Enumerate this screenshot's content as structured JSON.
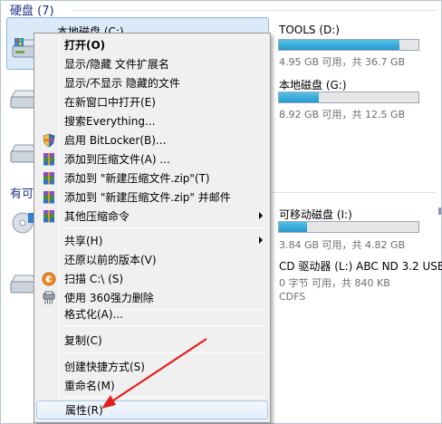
{
  "explorer": {
    "groups": [
      {
        "label": "硬盘 (7)"
      },
      {
        "label": "有可"
      }
    ],
    "drives": [
      {
        "name": "本地磁盘 (C:)",
        "usage": 0.0
      },
      {
        "name": "TOOLS (D:)",
        "info": "4.95 GB 可用，共 36.7 GB",
        "usage": 0.865
      },
      {
        "name": "本地磁盘 (G:)",
        "info": "8.92 GB 可用，共 12.5 GB",
        "usage": 0.286
      },
      {
        "name": "可移动磁盘 (I:)",
        "info": "3.84 GB 可用，共 4.82 GB",
        "usage": 0.203
      },
      {
        "name": "CD 驱动器 (L:) ABC ND 3.2 USE",
        "info": "0 字节 可用，共 840 KB",
        "info2": "CDFS"
      }
    ]
  },
  "menu": {
    "items": [
      {
        "label": "打开(O)",
        "bold": true
      },
      {
        "label": "显示/隐藏 文件扩展名"
      },
      {
        "label": "显示/不显示 隐藏的文件"
      },
      {
        "label": "在新窗口中打开(E)"
      },
      {
        "label": "搜索Everything..."
      },
      {
        "label": "启用 BitLocker(B)...",
        "icon": "shield-icon"
      },
      {
        "label": "添加到压缩文件(A) ...",
        "icon": "archive-icon"
      },
      {
        "label": "添加到 \"新建压缩文件.zip\"(T)",
        "icon": "archive-icon"
      },
      {
        "label": "添加到 \"新建压缩文件.zip\" 并邮件",
        "icon": "archive-icon"
      },
      {
        "label": "其他压缩命令",
        "icon": "archive-icon",
        "submenu": true
      },
      {
        "label": "共享(H)",
        "submenu": true
      },
      {
        "label": "还原以前的版本(V)"
      },
      {
        "label": "扫描 C:\\ (S)",
        "icon": "scan-icon"
      },
      {
        "label": "使用 360强力删除",
        "icon": "shredder-icon"
      },
      {
        "label": "格式化(A)..."
      },
      {
        "label": "复制(C)"
      },
      {
        "label": "创建快捷方式(S)"
      },
      {
        "label": "重命名(M)"
      },
      {
        "label": "属性(R)"
      }
    ]
  },
  "colors": {
    "annotation": "#e2211c",
    "bar_fill": "#2698cf",
    "group_header": "#1e3287"
  }
}
